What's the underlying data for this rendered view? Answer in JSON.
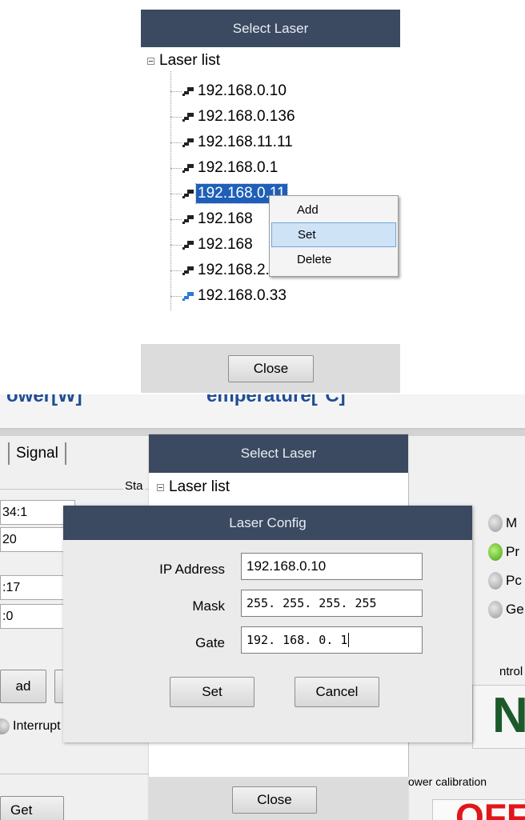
{
  "top_dialog": {
    "title": "Select Laser",
    "tree_root": "Laser list",
    "items": [
      {
        "label": "192.168.0.10",
        "icon": "network-device-icon"
      },
      {
        "label": "192.168.0.136",
        "icon": "network-device-icon"
      },
      {
        "label": "192.168.11.11",
        "icon": "network-device-icon"
      },
      {
        "label": "192.168.0.1",
        "icon": "network-device-icon"
      },
      {
        "label": "192.168.0.11",
        "icon": "network-device-icon",
        "selected": true
      },
      {
        "label": "192.168",
        "icon": "network-device-icon"
      },
      {
        "label": "192.168",
        "icon": "network-device-icon"
      },
      {
        "label": "192.168.2.10",
        "icon": "network-device-icon"
      },
      {
        "label": "192.168.0.33",
        "icon": "network-device-active-icon"
      }
    ],
    "context_menu": [
      "Add",
      "Set",
      "Delete"
    ],
    "close_label": "Close"
  },
  "bottom": {
    "header_left": "ower[W]",
    "header_right": "emperature[°C]",
    "tab_label": "Signal",
    "status_group": "Sta",
    "left_fields": [
      "34:1",
      "20",
      ":17",
      ":0"
    ],
    "left_btn1": "ad",
    "interrupt_label": "Interrupt",
    "get_label": "Get",
    "right_items": [
      "M",
      "Pr",
      "Pc",
      "Ge"
    ],
    "control_label": "ntrol",
    "on_text": "N",
    "power_calibration": "ower  calibration",
    "off_text": "OFF",
    "select_dialog": {
      "title": "Select Laser",
      "tree_root": "Laser list",
      "close_label": "Close"
    },
    "config_dialog": {
      "title": "Laser Config",
      "ip_label": "IP Address",
      "ip_value": "192.168.0.10",
      "mask_label": "Mask",
      "mask_value": "255. 255. 255. 255",
      "gate_label": "Gate",
      "gate_value": "192. 168. 0. 1",
      "set_label": "Set",
      "cancel_label": "Cancel"
    }
  },
  "colors": {
    "title_bar": "#3b4a61",
    "selection": "#1f5fb8",
    "menu_highlight": "#cfe3f7",
    "on_green": "#1c5a2a",
    "off_red": "#e0161a"
  }
}
